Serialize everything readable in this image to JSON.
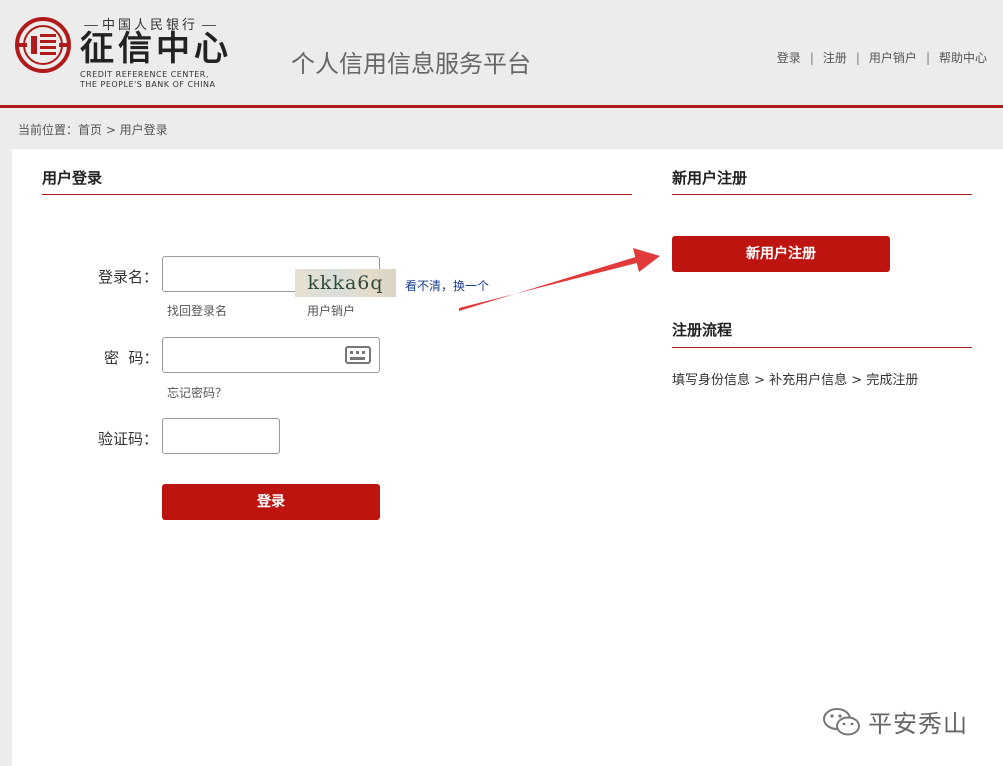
{
  "header": {
    "logo_top": "中国人民银行",
    "logo_main": "征信中心",
    "logo_en_line1": "CREDIT REFERENCE  CENTER,",
    "logo_en_line2": "THE PEOPLE'S BANK OF CHINA",
    "platform_title": "个人信用信息服务平台",
    "nav": [
      "登录",
      "注册",
      "用户销户",
      "帮助中心"
    ],
    "nav_separator": "|"
  },
  "breadcrumb": "当前位置：首页 > 用户登录",
  "login": {
    "title": "用户登录",
    "username_label": "登录名：",
    "username_value": "",
    "find_username": "找回登录名",
    "cancel_account": "用户销户",
    "password_label": "密  码：",
    "password_value": "",
    "forgot_password": "忘记密码？",
    "captcha_label": "验证码：",
    "captcha_value": "",
    "captcha_image_text": "kkka6q",
    "captcha_refresh": "看不清，换一个",
    "submit_label": "登录"
  },
  "register": {
    "title": "新用户注册",
    "button_label": "新用户注册",
    "process_title": "注册流程",
    "process_steps": "填写身份信息 > 补充用户信息 > 完成注册"
  },
  "watermark": {
    "text": "平安秀山",
    "icon": "wechat-icon"
  },
  "colors": {
    "brand_red": "#be1410",
    "divider_red": "#b11a1a",
    "link_blue": "#1b3f8f",
    "annotation_arrow": "#e03a3a"
  }
}
